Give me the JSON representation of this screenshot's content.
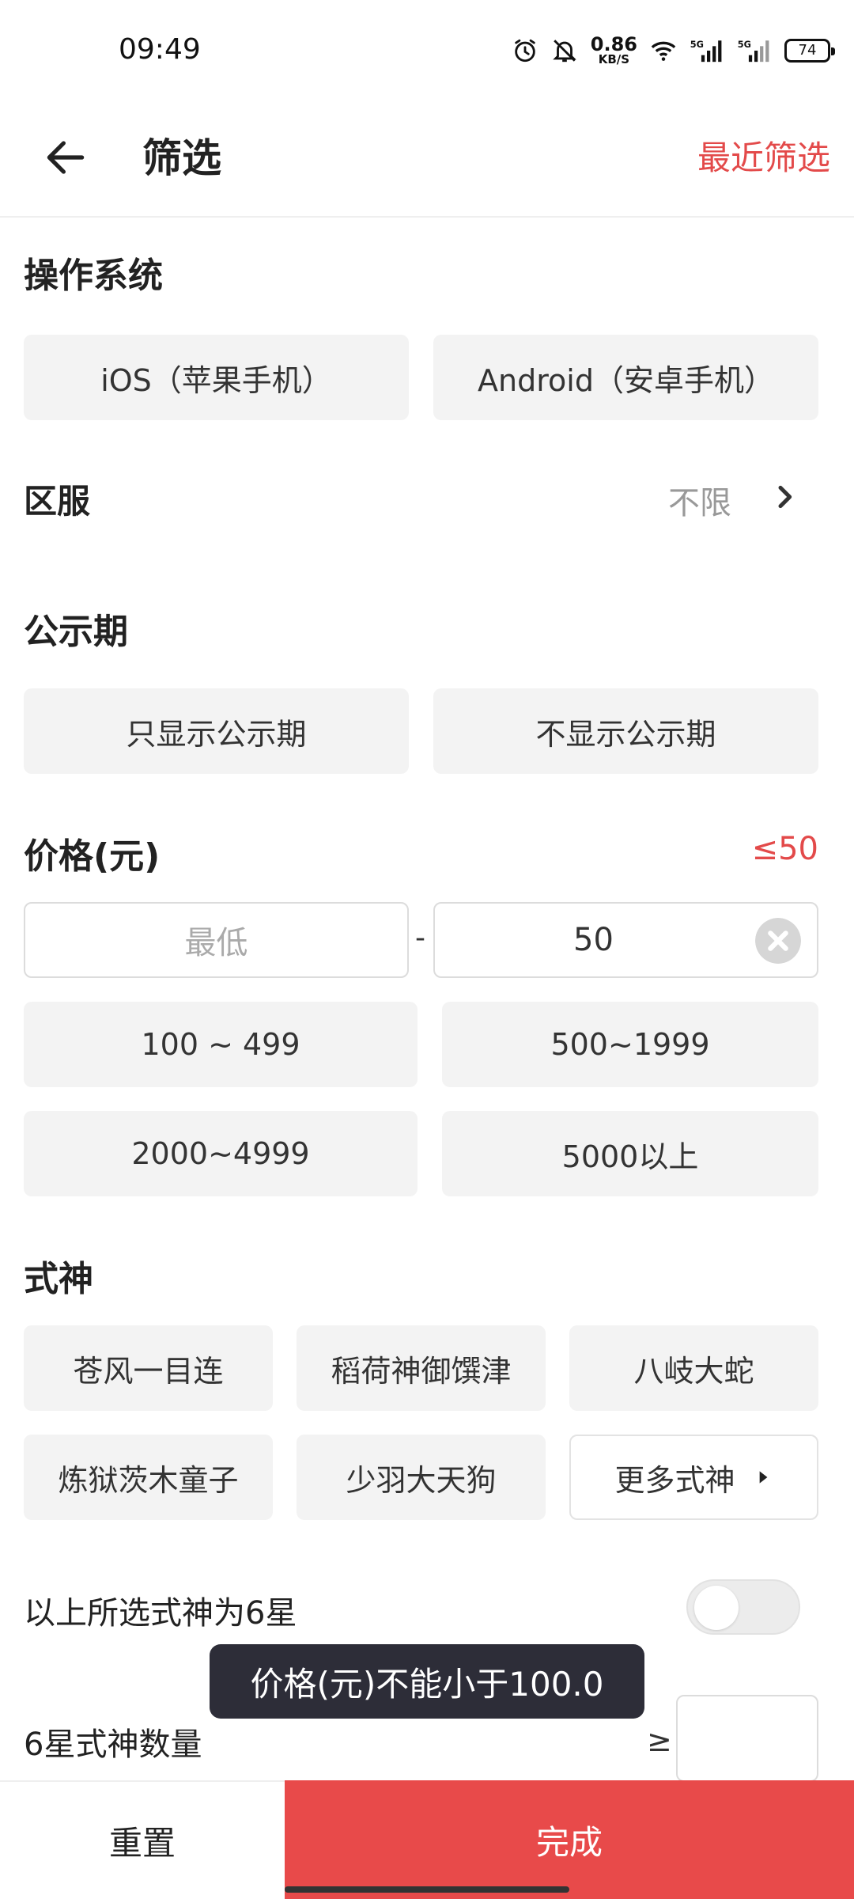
{
  "status_bar": {
    "time": "09:49",
    "net_speed_value": "0.86",
    "net_speed_unit": "KB/S",
    "signal1_label": "5G",
    "signal2_label": "5G",
    "battery": "74",
    "icons": [
      "alarm-icon",
      "mute-icon",
      "wifi-icon",
      "signal-icon",
      "battery-icon"
    ]
  },
  "header": {
    "title": "筛选",
    "recent_filter": "最近筛选"
  },
  "os": {
    "title": "操作系统",
    "options": [
      "iOS（苹果手机）",
      "Android（安卓手机）"
    ]
  },
  "region": {
    "label": "区服",
    "value": "不限"
  },
  "publicity": {
    "title": "公示期",
    "options": [
      "只显示公示期",
      "不显示公示期"
    ]
  },
  "price": {
    "title": "价格(元)",
    "limit": "≤50",
    "min_placeholder": "最低",
    "dash": "-",
    "max_value": "50",
    "ranges": [
      "100 ~ 499",
      "500~1999",
      "2000~4999",
      "5000以上"
    ]
  },
  "shishen": {
    "title": "式神",
    "options": [
      "苍风一目连",
      "稻荷神御馔津",
      "八岐大蛇",
      "炼狱茨木童子",
      "少羽大天狗"
    ],
    "more": "更多式神"
  },
  "six_star": {
    "label": "以上所选式神为6星",
    "enabled": false
  },
  "six_star_count": {
    "label": "6星式神数量",
    "ge": "≥"
  },
  "toast": {
    "message": "价格(元)不能小于100.0"
  },
  "bottom": {
    "reset": "重置",
    "done": "完成"
  },
  "colors": {
    "accent": "#e84a4a",
    "chip_bg": "#f3f3f3",
    "toast_bg": "#2d2d38"
  }
}
